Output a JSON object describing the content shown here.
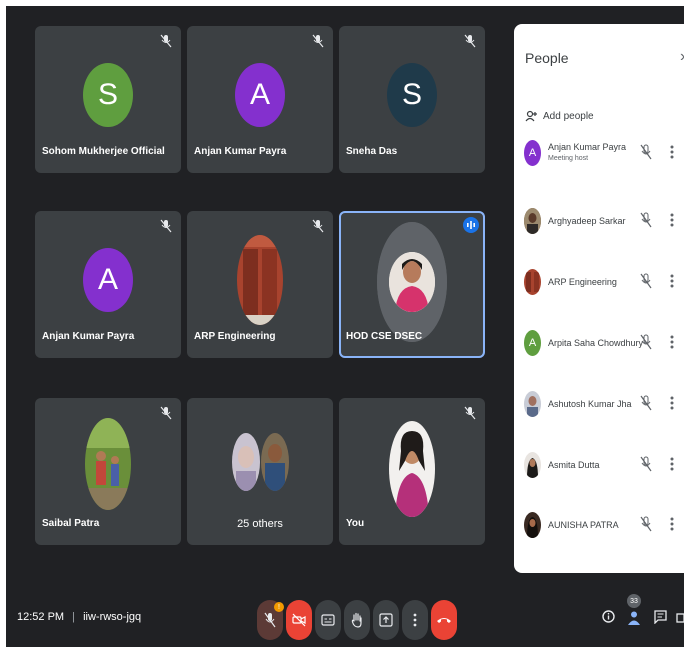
{
  "tiles": [
    {
      "name": "Sohom Mukherjee Official",
      "initial": "S",
      "color": "#5f9e3f"
    },
    {
      "name": "Anjan Kumar Payra",
      "initial": "A",
      "color": "#8430ce"
    },
    {
      "name": "Sneha Das",
      "initial": "S",
      "color": "#1f3a4a"
    },
    {
      "name": "Anjan Kumar Payra",
      "initial": "A",
      "color": "#8430ce"
    },
    {
      "name": "ARP Engineering"
    },
    {
      "name": "HOD CSE DSEC"
    },
    {
      "name": "Saibal Patra"
    },
    {
      "name": "25 others"
    },
    {
      "name": "You"
    }
  ],
  "panel": {
    "title": "People",
    "close_icon": "chevron-right-icon",
    "add_people": "Add people",
    "people": [
      {
        "name": "Anjan Kumar Payra",
        "role": "Meeting host",
        "initial": "A",
        "color": "#8430ce"
      },
      {
        "name": "Arghyadeep Sarkar"
      },
      {
        "name": "ARP Engineering"
      },
      {
        "name": "Arpita Saha Chowdhury",
        "initial": "A",
        "color": "#5f9e3f"
      },
      {
        "name": "Ashutosh Kumar Jha"
      },
      {
        "name": "Asmita Dutta"
      },
      {
        "name": "AUNISHA PATRA"
      }
    ]
  },
  "bottom_bar": {
    "time": "12:52 PM",
    "separator": "|",
    "meeting_code": "iiw-rwso-jgq",
    "participant_count": "33",
    "mic_warning": "!"
  },
  "colors": {
    "background": "#202124",
    "tile": "#3c4043",
    "red": "#ea4335",
    "blue": "#8ab4f8"
  }
}
